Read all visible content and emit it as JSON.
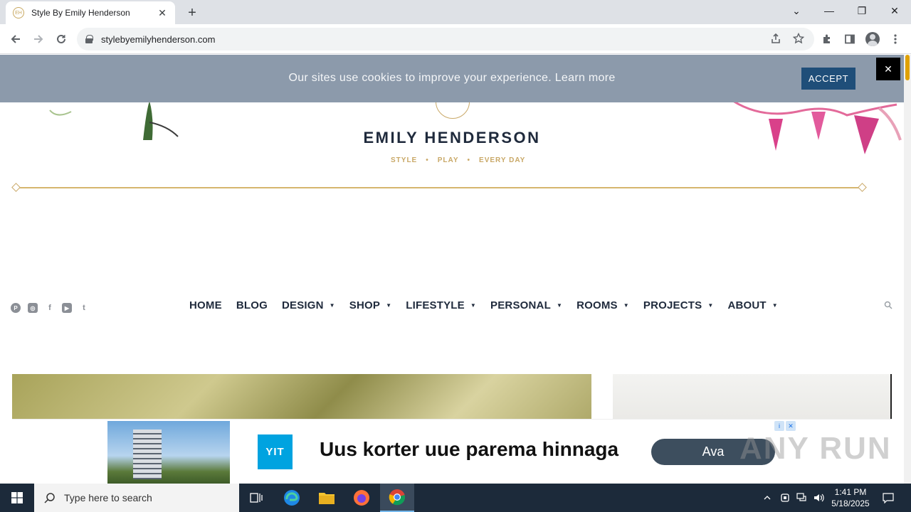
{
  "browser": {
    "tab_title": "Style By Emily Henderson",
    "tab_close": "✕",
    "new_tab": "+",
    "url": "stylebyemilyhenderson.com",
    "window_controls": [
      "⌄",
      "—",
      "❐",
      "✕"
    ]
  },
  "cookie_banner": {
    "message": "Our sites use cookies to improve your experience. Learn more",
    "accept_label": "ACCEPT",
    "close_label": "✕"
  },
  "site": {
    "logo_name": "EMILY HENDERSON",
    "tagline": [
      "STYLE",
      "PLAY",
      "EVERY DAY"
    ],
    "tagline_separator": "•",
    "social": [
      "pinterest",
      "instagram",
      "facebook",
      "youtube",
      "twitter"
    ],
    "nav": [
      {
        "label": "HOME",
        "has_caret": false
      },
      {
        "label": "BLOG",
        "has_caret": false
      },
      {
        "label": "DESIGN",
        "has_caret": true
      },
      {
        "label": "SHOP",
        "has_caret": true
      },
      {
        "label": "LIFESTYLE",
        "has_caret": true
      },
      {
        "label": "PERSONAL",
        "has_caret": true
      },
      {
        "label": "ROOMS",
        "has_caret": true
      },
      {
        "label": "PROJECTS",
        "has_caret": true
      },
      {
        "label": "ABOUT",
        "has_caret": true
      }
    ],
    "caret_glyph": "▼"
  },
  "ad": {
    "logo_text": "YIT",
    "headline": "Uus korter uue parema hinnaga",
    "cta_label": "Ava",
    "watermark": "ANY RUN"
  },
  "taskbar": {
    "search_placeholder": "Type here to search",
    "time": "1:41 PM",
    "date": "5/18/2025"
  }
}
